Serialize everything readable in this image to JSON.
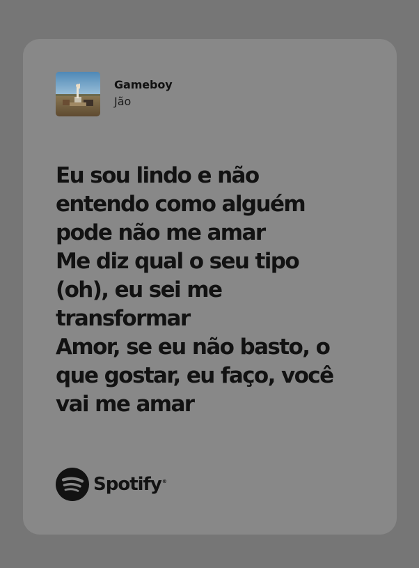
{
  "track": {
    "title": "Gameboy",
    "artist": "Jão"
  },
  "lyrics": {
    "lines": [
      "Eu sou lindo e não",
      "entendo como alguém",
      "pode não me amar",
      "Me diz qual o seu tipo",
      "(oh), eu sei me",
      "transformar",
      "Amor, se eu não basto, o",
      "que gostar, eu faço, você",
      "vai me amar"
    ]
  },
  "brand": {
    "name": "Spotify",
    "registered_mark": "®",
    "logo_icon": "spotify-logo-icon"
  },
  "colors": {
    "background": "#767676",
    "card": "#888888",
    "text": "#121212"
  }
}
